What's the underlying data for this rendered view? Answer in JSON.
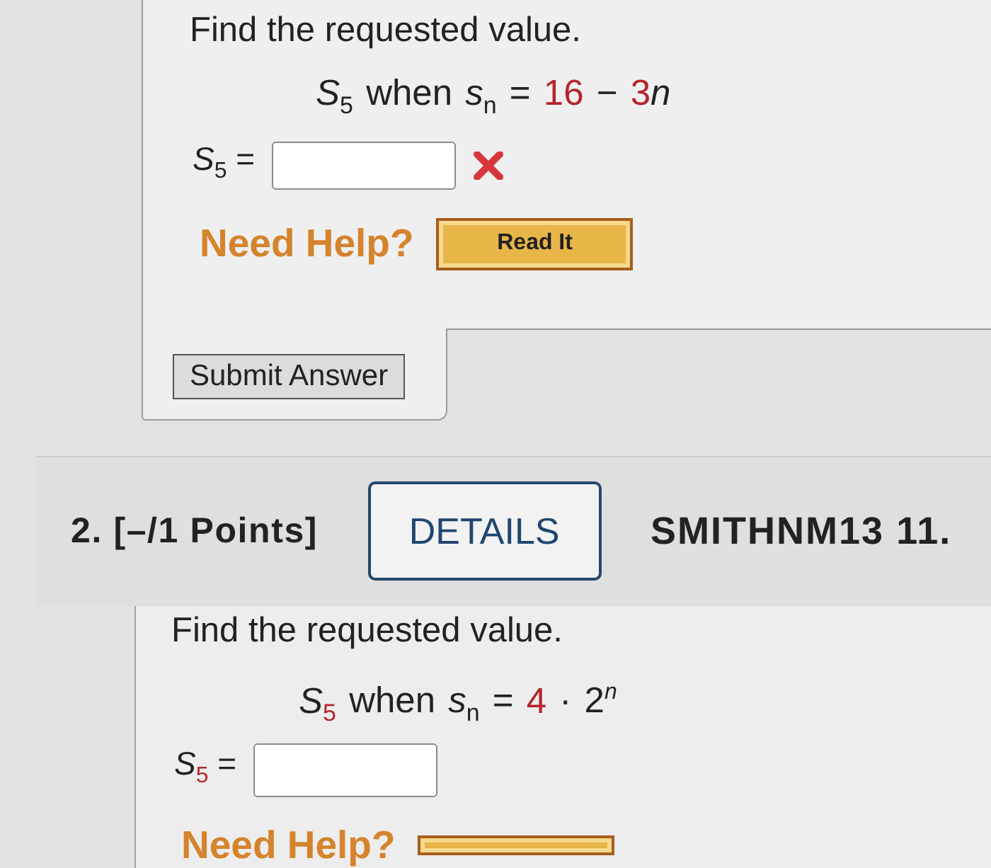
{
  "questions": [
    {
      "prompt": "Find the requested value.",
      "formula": [
        {
          "text": "*S*$_{5}$ when *s*$_{n}$ = ",
          "highlight": false
        },
        {
          "text": "16",
          "highlight": true
        },
        {
          "text": " − ",
          "highlight": false
        },
        {
          "text": "3",
          "highlight": true
        },
        {
          "text": "*n*",
          "highlight": false
        }
      ],
      "answer": {
        "label": [
          {
            "text": "*S*$_{5}$ =",
            "highlight": false
          }
        ],
        "incorrect": true
      },
      "help": {
        "label": "Need Help?",
        "buttons": [
          {
            "kind": "read",
            "label": "Read It"
          }
        ]
      },
      "submit": "Submit Answer"
    },
    {
      "header": {
        "points": "2. [–/1 Points]",
        "details": "DETAILS",
        "source": "SMITHNM13 11."
      },
      "prompt": "Find the requested value.",
      "formula": [
        {
          "text": "*S*",
          "highlight": false
        },
        {
          "text": "$_{5}$",
          "highlight": true
        },
        {
          "text": " when *s*$_{n}$ = ",
          "highlight": false
        },
        {
          "text": "4",
          "highlight": true
        },
        {
          "text": " · 2$^{n}$",
          "highlight": false
        }
      ],
      "answer": {
        "label": [
          {
            "text": "*S*",
            "highlight": false
          },
          {
            "text": "$_{5}$",
            "highlight": true
          },
          {
            "text": " =",
            "highlight": false
          }
        ],
        "incorrect": false
      },
      "help": {
        "label": "Need Help?",
        "buttons": [
          {
            "kind": "read"
          }
        ]
      }
    }
  ]
}
